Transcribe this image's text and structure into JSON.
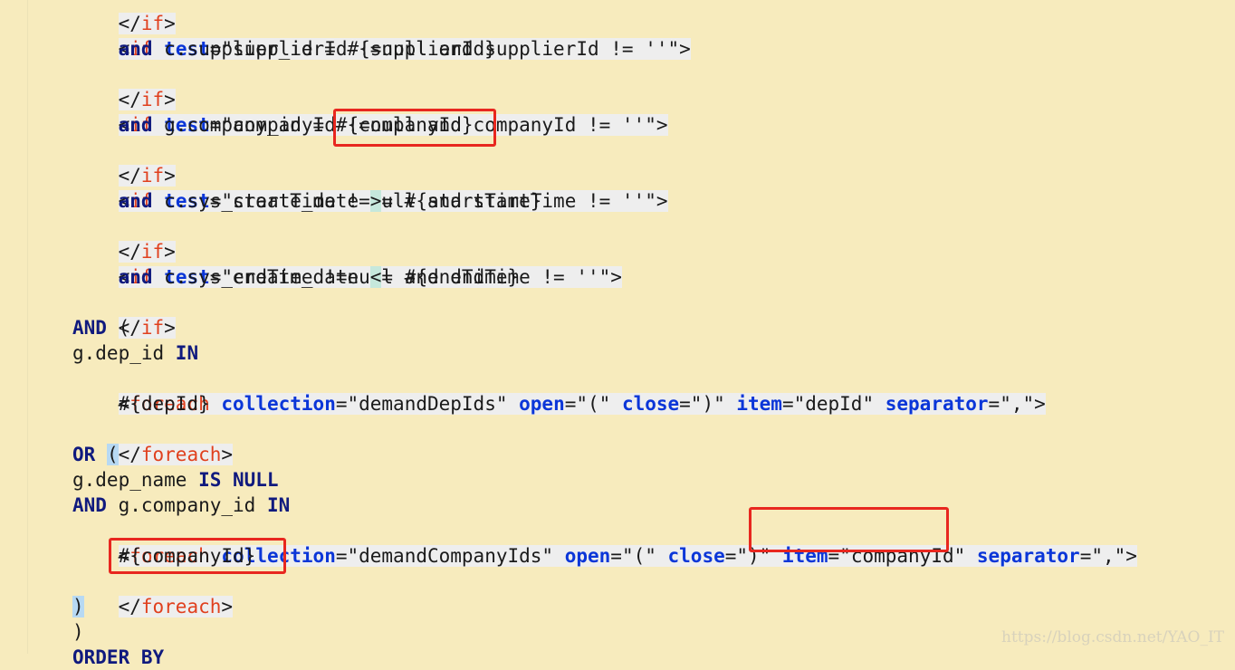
{
  "editor": {
    "lines": {
      "l0": "</if>",
      "l1": "<if test=\"supplierId !=null and supplierId != ''\">",
      "l2": "    and c.supplier_id = #{supplierId}",
      "l3": "</if>",
      "l4": "<if test=\"companyId !=null and companyId != ''\">",
      "l5": "    and g.company_id = #{companyId}",
      "l6": "</if>",
      "l7": "<if test=\"startTime !=null and startTime != ''\">",
      "l8": "    and c.sys_create_date >= #{startTime}",
      "l9": "</if>",
      "l10": "<if test=\"endTime !=null and endTime != ''\">",
      "l11": "    and c.sys_create_date <= #{endTime}",
      "l12": "</if>",
      "l13": "AND (",
      "l14": "g.dep_id IN",
      "l15": "<foreach collection=\"demandDepIds\" open=\"(\" close=\")\" item=\"depId\" separator=\",\">",
      "l16": "    #{depId}",
      "l17": "</foreach>",
      "l18": "OR (",
      "l19": "g.dep_name IS NULL",
      "l20": "AND g.company_id IN",
      "l21": "<foreach collection=\"demandCompanyIds\" open=\"(\" close=\")\" item=\"companyId\" separator=\",\">",
      "l22": "    #{companyId}",
      "l23": "</foreach>",
      "l24": ")",
      "l25": ")",
      "l26": "ORDER BY"
    }
  },
  "watermark": "https://blog.csdn.net/YAO_IT",
  "colors": {
    "background": "#f7ebbd",
    "tag_name": "#e0401e",
    "attribute": "#0b36d8",
    "sql_keyword": "#101a7e",
    "highlight_box": "#e8271f"
  }
}
